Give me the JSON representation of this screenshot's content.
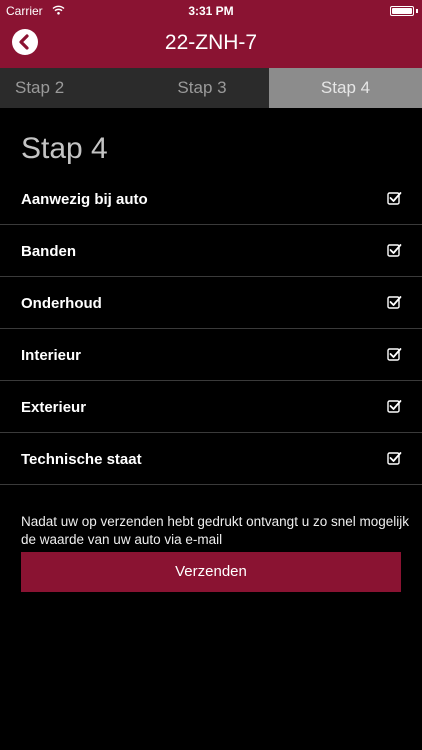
{
  "statusbar": {
    "carrier": "Carrier",
    "time": "3:31 PM"
  },
  "nav": {
    "title": "22-ZNH-7",
    "back_icon": "chevron-left-icon"
  },
  "tabs": [
    {
      "label": "Stap 2",
      "active": false
    },
    {
      "label": "Stap 3",
      "active": false
    },
    {
      "label": "Stap 4",
      "active": true
    }
  ],
  "page": {
    "heading": "Stap 4"
  },
  "checklist": [
    {
      "label": "Aanwezig bij auto",
      "checked": true
    },
    {
      "label": "Banden",
      "checked": true
    },
    {
      "label": "Onderhoud",
      "checked": true
    },
    {
      "label": "Interieur",
      "checked": true
    },
    {
      "label": "Exterieur",
      "checked": true
    },
    {
      "label": "Technische staat",
      "checked": true
    }
  ],
  "footer": {
    "note": "Nadat uw op verzenden hebt gedrukt ontvangt u zo snel mogelijk de waarde van uw auto via e-mail",
    "submit_label": "Verzenden"
  },
  "colors": {
    "brand": "#8a1332",
    "active_tab": "#8c8c8c",
    "tab_bar": "#2b2b2b"
  }
}
